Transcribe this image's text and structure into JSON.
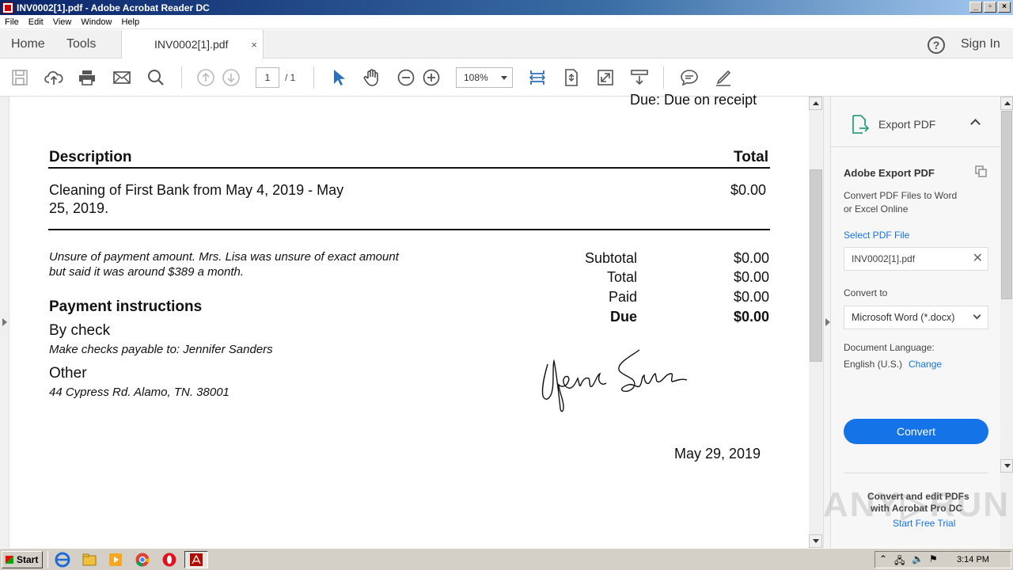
{
  "window": {
    "title": "INV0002[1].pdf - Adobe Acrobat Reader DC"
  },
  "menu": [
    "File",
    "Edit",
    "View",
    "Window",
    "Help"
  ],
  "tabs": {
    "home": "Home",
    "tools": "Tools",
    "document": "INV0002[1].pdf",
    "close": "×",
    "signin": "Sign In",
    "help": "?"
  },
  "toolbar": {
    "page_current": "1",
    "page_total": "/ 1",
    "zoom": "108%"
  },
  "document": {
    "due_header": "Due: Due on receipt",
    "col_description": "Description",
    "col_total": "Total",
    "item_line1": "Cleaning of First Bank from May 4, 2019 - May",
    "item_line2": "25, 2019.",
    "item_amount": "$0.00",
    "note_line1": "Unsure of payment amount. Mrs. Lisa was unsure of exact amount",
    "note_line2": "but said it was around $389 a month.",
    "summary": [
      {
        "label": "Subtotal",
        "value": "$0.00",
        "bold": false
      },
      {
        "label": "Total",
        "value": "$0.00",
        "bold": false
      },
      {
        "label": "Paid",
        "value": "$0.00",
        "bold": false
      },
      {
        "label": "Due",
        "value": "$0.00",
        "bold": true
      }
    ],
    "payment_heading": "Payment instructions",
    "by_check": "By check",
    "payable_to": "Make checks payable to: Jennifer Sanders",
    "other": "Other",
    "address": "44 Cypress Rd. Alamo, TN. 38001",
    "date": "May 29, 2019"
  },
  "export_panel": {
    "header": "Export PDF",
    "title": "Adobe Export PDF",
    "desc_line1": "Convert PDF Files to Word",
    "desc_line2": "or Excel Online",
    "select_file": "Select PDF File",
    "file_name": "INV0002[1].pdf",
    "convert_to_label": "Convert to",
    "convert_to_value": "Microsoft Word (*.docx)",
    "doc_lang_label": "Document Language:",
    "doc_lang_value": "English (U.S.)",
    "change": "Change",
    "convert_button": "Convert",
    "promo_line1": "Convert and edit PDFs",
    "promo_line2": "with Acrobat Pro DC",
    "promo_link": "Start Free Trial"
  },
  "taskbar": {
    "start": "Start",
    "clock": "3:14 PM"
  },
  "colors": {
    "accent": "#1473e6",
    "toolbar_blue": "#2d6fb8"
  }
}
